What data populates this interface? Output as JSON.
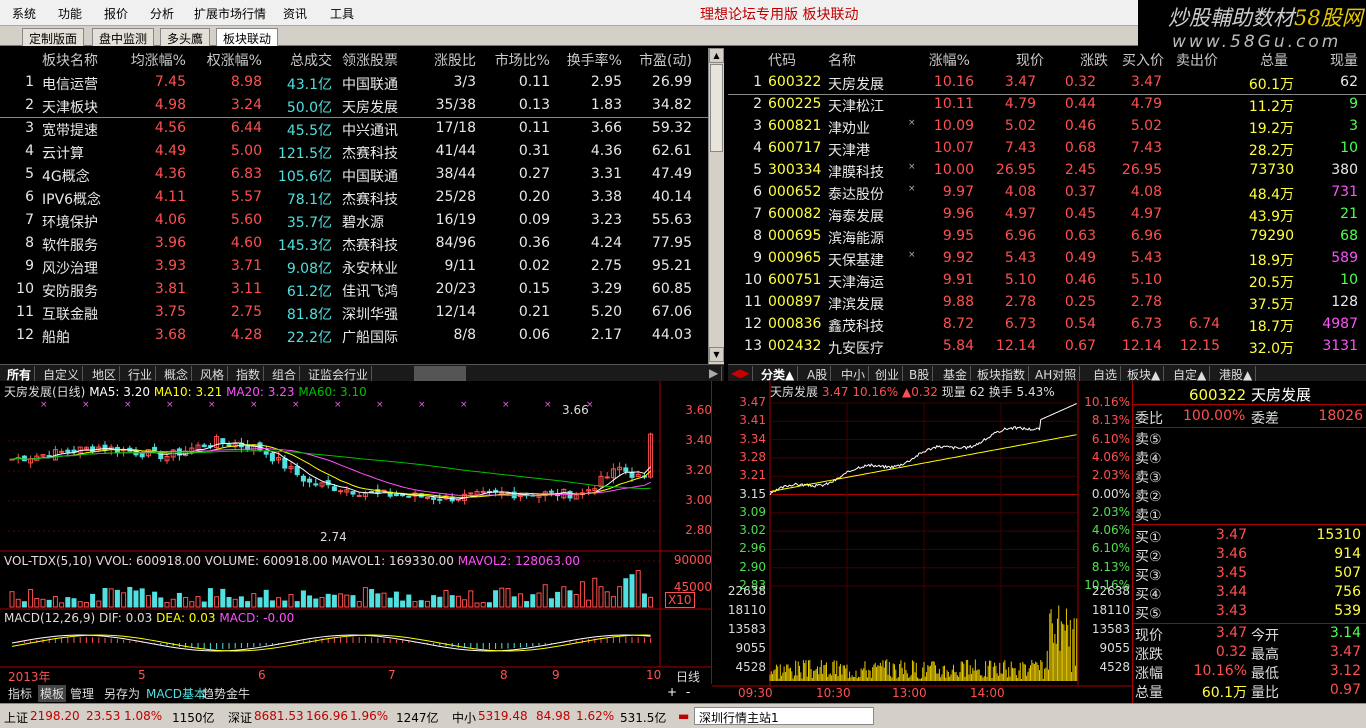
{
  "menu": [
    "系统",
    "功能",
    "报价",
    "分析",
    "扩展市场行情",
    "资讯",
    "工具"
  ],
  "window_title": "理想论坛专用版  板块联动",
  "logo": {
    "line1a": "炒股輔助数材",
    "line1b": "58股网",
    "line2": "www.58Gu.com"
  },
  "tabs": [
    "定制版面",
    "盘中监测",
    "多头鷹",
    "板块联动"
  ],
  "sectors": {
    "headers": [
      "板块名称",
      "均涨幅%",
      "权涨幅%",
      "总成交",
      "领涨股票",
      "涨股比",
      "市场比%",
      "换手率%",
      "市盈(动)"
    ],
    "rows": [
      [
        "1",
        "电信运营",
        "7.45",
        "8.98",
        "43.1亿",
        "中国联通",
        "3/3",
        "0.11",
        "2.95",
        "26.99"
      ],
      [
        "2",
        "天津板块",
        "4.98",
        "3.24",
        "50.0亿",
        "天房发展",
        "35/38",
        "0.13",
        "1.83",
        "34.82"
      ],
      [
        "3",
        "宽带提速",
        "4.56",
        "6.44",
        "45.5亿",
        "中兴通讯",
        "17/18",
        "0.11",
        "3.66",
        "59.32"
      ],
      [
        "4",
        "云计算",
        "4.49",
        "5.00",
        "121.5亿",
        "杰赛科技",
        "41/44",
        "0.31",
        "4.36",
        "62.61"
      ],
      [
        "5",
        "4G概念",
        "4.36",
        "6.83",
        "105.6亿",
        "中国联通",
        "38/44",
        "0.27",
        "3.31",
        "47.49"
      ],
      [
        "6",
        "IPV6概念",
        "4.11",
        "5.57",
        "78.1亿",
        "杰赛科技",
        "25/28",
        "0.20",
        "3.38",
        "40.14"
      ],
      [
        "7",
        "环境保护",
        "4.06",
        "5.60",
        "35.7亿",
        "碧水源",
        "16/19",
        "0.09",
        "3.23",
        "55.63"
      ],
      [
        "8",
        "软件服务",
        "3.96",
        "4.60",
        "145.3亿",
        "杰赛科技",
        "84/96",
        "0.36",
        "4.24",
        "77.95"
      ],
      [
        "9",
        "风沙治理",
        "3.93",
        "3.71",
        "9.08亿",
        "永安林业",
        "9/11",
        "0.02",
        "2.75",
        "95.21"
      ],
      [
        "10",
        "安防服务",
        "3.81",
        "3.11",
        "61.2亿",
        "佳讯飞鸿",
        "20/23",
        "0.15",
        "3.29",
        "60.85"
      ],
      [
        "11",
        "互联金融",
        "3.75",
        "2.75",
        "81.8亿",
        "深圳华强",
        "12/14",
        "0.21",
        "5.20",
        "67.06"
      ],
      [
        "12",
        "船舶",
        "3.68",
        "4.28",
        "22.2亿",
        "广船国际",
        "8/8",
        "0.06",
        "2.17",
        "44.03"
      ]
    ]
  },
  "stocks": {
    "headers": [
      "代码",
      "名称",
      "涨幅%",
      "现价",
      "涨跌",
      "买入价",
      "卖出价",
      "总量",
      "现量"
    ],
    "rows": [
      [
        "1",
        "600322",
        "天房发展",
        "",
        "10.16",
        "3.47",
        "0.32",
        "3.47",
        "",
        "60.1万",
        "62"
      ],
      [
        "2",
        "600225",
        "天津松江",
        "",
        "10.11",
        "4.79",
        "0.44",
        "4.79",
        "",
        "11.2万",
        "9"
      ],
      [
        "3",
        "600821",
        "津劝业",
        "×",
        "10.09",
        "5.02",
        "0.46",
        "5.02",
        "",
        "19.2万",
        "3"
      ],
      [
        "4",
        "600717",
        "天津港",
        "",
        "10.07",
        "7.43",
        "0.68",
        "7.43",
        "",
        "28.2万",
        "10"
      ],
      [
        "5",
        "300334",
        "津膜科技",
        "×",
        "10.00",
        "26.95",
        "2.45",
        "26.95",
        "",
        "73730",
        "380"
      ],
      [
        "6",
        "000652",
        "泰达股份",
        "×",
        "9.97",
        "4.08",
        "0.37",
        "4.08",
        "",
        "48.4万",
        "731"
      ],
      [
        "7",
        "600082",
        "海泰发展",
        "",
        "9.96",
        "4.97",
        "0.45",
        "4.97",
        "",
        "43.9万",
        "21"
      ],
      [
        "8",
        "000695",
        "滨海能源",
        "",
        "9.95",
        "6.96",
        "0.63",
        "6.96",
        "",
        "79290",
        "68"
      ],
      [
        "9",
        "000965",
        "天保基建",
        "×",
        "9.92",
        "5.43",
        "0.49",
        "5.43",
        "",
        "18.9万",
        "589"
      ],
      [
        "10",
        "600751",
        "天津海运",
        "",
        "9.91",
        "5.10",
        "0.46",
        "5.10",
        "",
        "20.5万",
        "10"
      ],
      [
        "11",
        "000897",
        "津滨发展",
        "",
        "9.88",
        "2.78",
        "0.25",
        "2.78",
        "",
        "37.5万",
        "128"
      ],
      [
        "12",
        "000836",
        "鑫茂科技",
        "",
        "8.72",
        "6.73",
        "0.54",
        "6.73",
        "6.74",
        "18.7万",
        "4987"
      ],
      [
        "13",
        "002432",
        "九安医疗",
        "",
        "5.84",
        "12.14",
        "0.67",
        "12.14",
        "12.15",
        "32.0万",
        "3131"
      ]
    ]
  },
  "left_cats": [
    "所有",
    "自定义",
    "地区",
    "行业",
    "概念",
    "风格",
    "指数",
    "组合",
    "证监会行业"
  ],
  "right_cats": [
    "分类▲",
    "A股",
    "中小",
    "创业",
    "B股",
    "基金",
    "板块指数",
    "AH对照",
    "自选",
    "板块▲",
    "自定▲",
    "港股▲"
  ],
  "kline": {
    "title": "天房发展(日线)",
    "ma5": "MA5: 3.20",
    "ma10": "MA10: 3.21",
    "ma20": "MA20: 3.23",
    "ma60": "MA60: 3.10",
    "yaxis": [
      "3.60",
      "3.40",
      "3.20",
      "3.00",
      "2.80"
    ],
    "high_label": "3.66",
    "low_label": "2.74",
    "vol_title": "VOL-TDX(5,10)",
    "vvol": "VVOL: 600918.00",
    "volume": "VOLUME: 600918.00",
    "mavol1": "MAVOL1: 169330.00",
    "mavol2": "MAVOL2: 128063.00",
    "vol_axis": [
      "90000",
      "45000"
    ],
    "x10": "X10",
    "macd_title": "MACD(12,26,9)",
    "dif": "DIF: 0.03",
    "dea": "DEA: 0.03",
    "macd": "MACD: -0.00",
    "xaxis": [
      "2013年",
      "5",
      "6",
      "7",
      "8",
      "9",
      "10"
    ],
    "period": "日线"
  },
  "intraday": {
    "name": "天房发展",
    "price": "3.47",
    "pct": "10.16%",
    "chg": "▲0.32",
    "now_vol": "现量 62",
    "turnover": "换手 5.43%",
    "left_axis": [
      "3.47",
      "3.41",
      "3.34",
      "3.28",
      "3.21",
      "3.15",
      "3.09",
      "3.02",
      "2.96",
      "2.90",
      "2.83"
    ],
    "right_axis": [
      "10.16%",
      "8.13%",
      "6.10%",
      "4.06%",
      "2.03%",
      "0.00%",
      "2.03%",
      "4.06%",
      "6.10%",
      "8.13%",
      "10.16%"
    ],
    "vol_axis": [
      "22638",
      "18110",
      "13583",
      "9055",
      "4528"
    ],
    "times": [
      "09:30",
      "10:30",
      "13:00",
      "14:00"
    ]
  },
  "quote": {
    "code": "600322",
    "name": "天房发展",
    "weibi_label": "委比",
    "weibi": "100.00%",
    "weicha_label": "委差",
    "weicha": "18026",
    "sells": [
      "卖⑤",
      "卖④",
      "卖③",
      "卖②",
      "卖①"
    ],
    "buys": [
      [
        "买①",
        "3.47",
        "15310"
      ],
      [
        "买②",
        "3.46",
        "914"
      ],
      [
        "买③",
        "3.45",
        "507"
      ],
      [
        "买④",
        "3.44",
        "756"
      ],
      [
        "买⑤",
        "3.43",
        "539"
      ]
    ],
    "stats": [
      [
        "现价",
        "3.47",
        "今开",
        "3.14"
      ],
      [
        "涨跌",
        "0.32",
        "最高",
        "3.47"
      ],
      [
        "涨幅",
        "10.16%",
        "最低",
        "3.12"
      ],
      [
        "总量",
        "60.1万",
        "量比",
        "0.97"
      ]
    ]
  },
  "bottom_tabs": [
    "指标",
    "模板",
    "管理",
    "另存为",
    "MACD基本",
    "趋势金牛"
  ],
  "status": {
    "sh_label": "上证",
    "sh": "2198.20",
    "sh_chg": "23.53",
    "sh_pct": "1.08%",
    "sh_amt": "1150亿",
    "sz_label": "深证",
    "sz": "8681.53",
    "sz_chg": "166.96",
    "sz_pct": "1.96%",
    "sz_amt": "1247亿",
    "zx_label": "中小",
    "zx": "5319.48",
    "zx_chg": "84.98",
    "zx_pct": "1.62%",
    "zx_amt": "531.5亿",
    "server": "深圳行情主站1"
  },
  "colors": {
    "up": "#ff5050",
    "down": "#50ff50",
    "ma5": "#ffffff",
    "ma10": "#ffff00",
    "ma20": "#ff50ff",
    "ma60": "#00c000"
  }
}
